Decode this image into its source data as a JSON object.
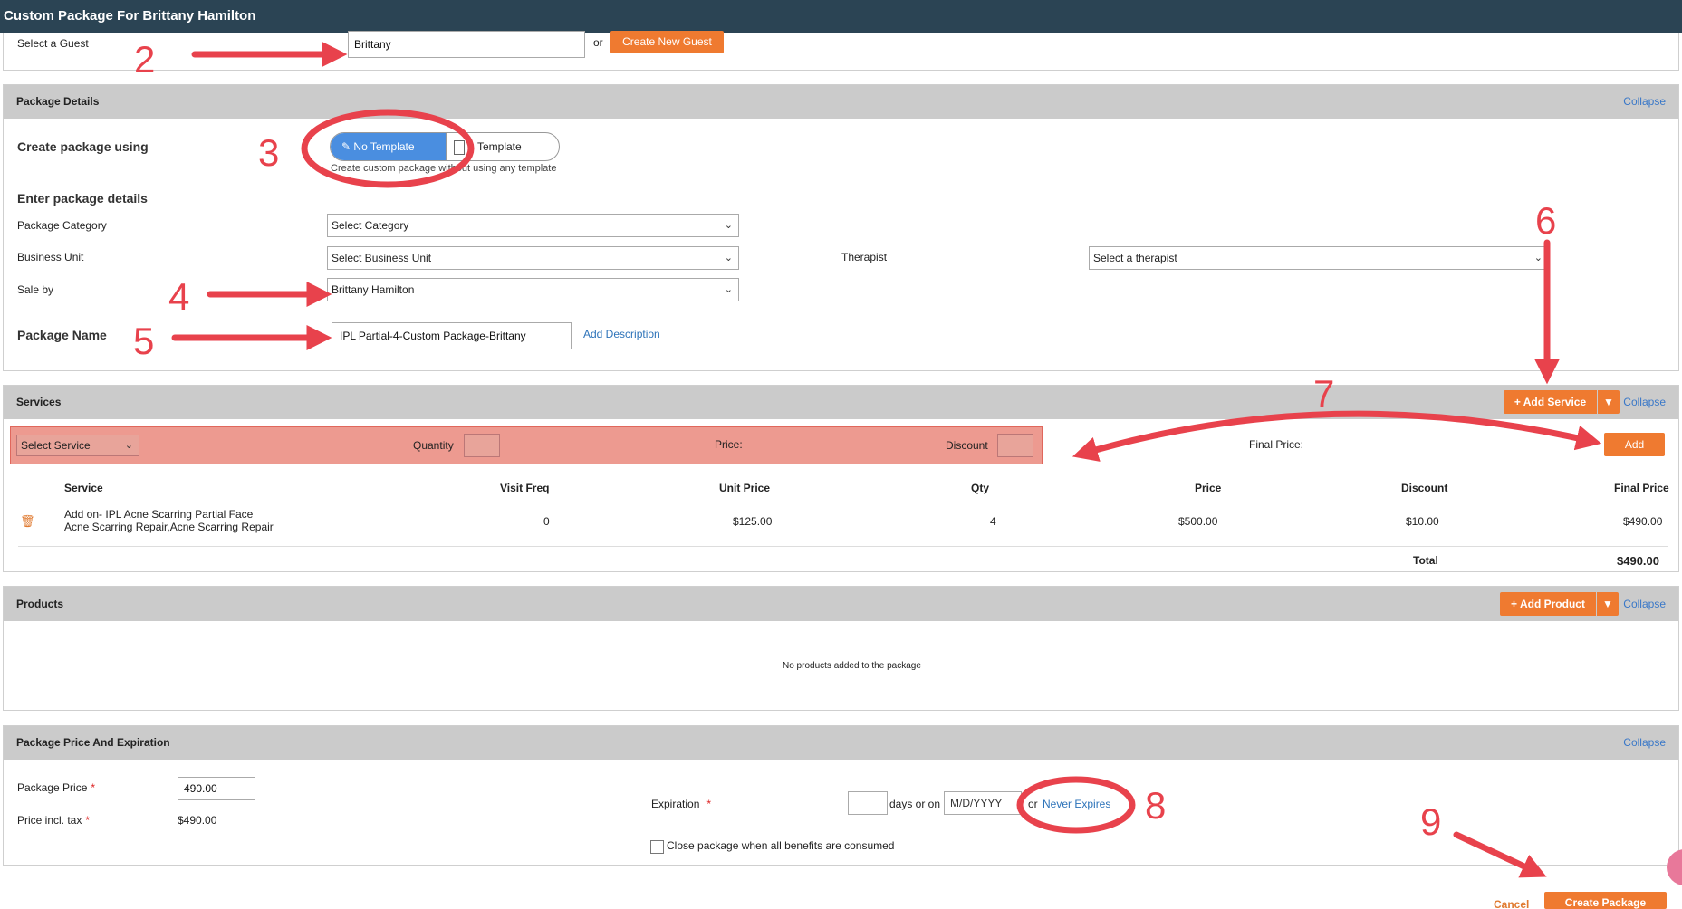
{
  "window": {
    "title": "Custom Package For Brittany Hamilton"
  },
  "guest": {
    "label": "Select a Guest",
    "value": "Brittany",
    "or": "or",
    "create_button": "Create New Guest"
  },
  "details": {
    "header": "Package Details",
    "collapse": "Collapse",
    "create_using_label": "Create package using",
    "no_template": "No Template",
    "template": "Template",
    "template_hint": "Create custom package without using any template",
    "enter_details": "Enter package details",
    "category_label": "Package Category",
    "category_value": "Select Category",
    "bu_label": "Business Unit",
    "bu_value": "Select Business Unit",
    "therapist_label": "Therapist",
    "therapist_value": "Select a therapist",
    "saleby_label": "Sale by",
    "saleby_value": "Brittany Hamilton",
    "name_label": "Package Name",
    "name_value": "IPL Partial-4-Custom Package-Brittany",
    "add_description": "Add Description"
  },
  "services": {
    "header": "Services",
    "add_service": "+ Add Service",
    "collapse": "Collapse",
    "select_service": "Select Service",
    "quantity": "Quantity",
    "price": "Price:",
    "discount": "Discount",
    "final_price": "Final Price:",
    "add_button": "Add",
    "columns": {
      "service": "Service",
      "visit_freq": "Visit Freq",
      "unit_price": "Unit Price",
      "qty": "Qty",
      "price": "Price",
      "discount": "Discount",
      "final_price": "Final Price"
    },
    "rows": [
      {
        "service_line1": "Add on- IPL Acne Scarring Partial Face",
        "service_line2": "Acne Scarring Repair,Acne Scarring Repair",
        "visit_freq": "0",
        "unit_price": "$125.00",
        "qty": "4",
        "price": "$500.00",
        "discount": "$10.00",
        "final_price": "$490.00"
      }
    ],
    "total_label": "Total",
    "total_value": "$490.00"
  },
  "products": {
    "header": "Products",
    "add_product": "+ Add Product",
    "collapse": "Collapse",
    "empty": "No products added to the package"
  },
  "pricing": {
    "header": "Package Price And Expiration",
    "collapse": "Collapse",
    "price_label": "Package Price",
    "price_value": "490.00",
    "incl_tax_label": "Price incl. tax",
    "incl_tax_value": "$490.00",
    "expiration_label": "Expiration",
    "days_or_on": "days or on",
    "date_placeholder": "M/D/YYYY",
    "or": "or",
    "never_expires": "Never Expires",
    "close_when_consumed": "Close package when all benefits are consumed"
  },
  "footer": {
    "cancel": "Cancel",
    "create": "Create Package"
  },
  "annotations": [
    "2",
    "3",
    "4",
    "5",
    "6",
    "7",
    "8",
    "9"
  ],
  "colors": {
    "accent": "#ef7a30",
    "header": "#2b4454",
    "selected": "#4a8ee0",
    "annotation": "#e8424c"
  }
}
